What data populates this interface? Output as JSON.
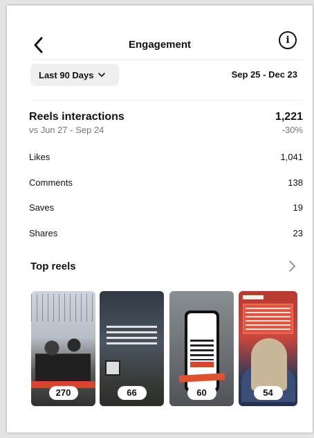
{
  "header": {
    "title": "Engagement",
    "back_icon": "chevron-left-icon",
    "info_icon": "info-icon",
    "info_glyph": "i"
  },
  "date_filter": {
    "selected": "Last 90 Days",
    "range": "Sep 25 - Dec 23"
  },
  "reels_interactions": {
    "label": "Reels interactions",
    "total": "1,221",
    "comparison_label": "vs Jun 27 - Sep 24",
    "change": "-30%",
    "stats": [
      {
        "label": "Likes",
        "value": "1,041"
      },
      {
        "label": "Comments",
        "value": "138"
      },
      {
        "label": "Saves",
        "value": "19"
      },
      {
        "label": "Shares",
        "value": "23"
      }
    ]
  },
  "top_reels": {
    "label": "Top reels",
    "items": [
      {
        "count": "270"
      },
      {
        "count": "66"
      },
      {
        "count": "60"
      },
      {
        "count": "54"
      }
    ]
  }
}
